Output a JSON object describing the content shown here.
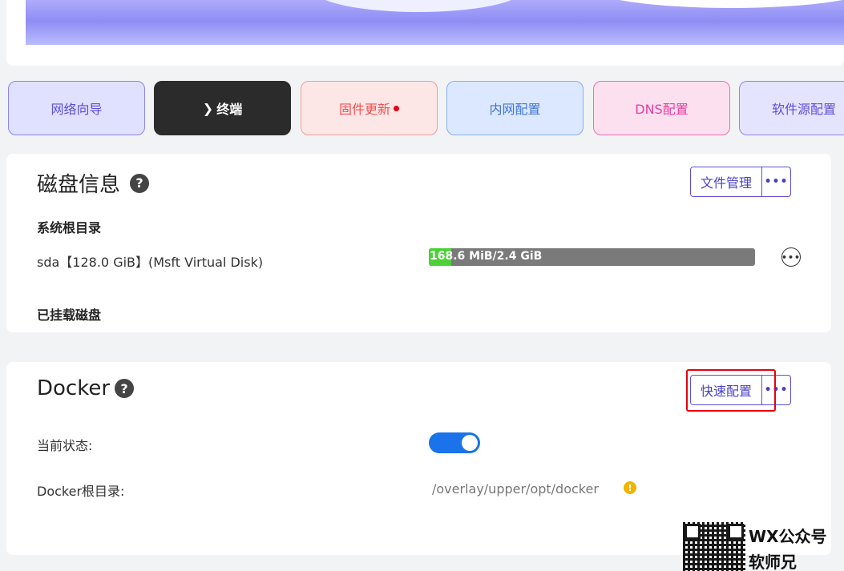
{
  "quick_buttons": {
    "network_wizard": "网络向导",
    "terminal": "终端",
    "firmware_update": "固件更新",
    "lan_config": "内网配置",
    "dns_config": "DNS配置",
    "software_source": "软件源配置"
  },
  "disk_card": {
    "title": "磁盘信息",
    "file_manage_label": "文件管理",
    "system_root_label": "系统根目录",
    "disk_name": "sda【128.0 GiB】(Msft Virtual Disk)",
    "usage_text": "168.6 MiB/2.4 GiB",
    "usage_fraction": 0.07,
    "mounted_label": "已挂载磁盘"
  },
  "docker_card": {
    "title": "Docker",
    "quick_config_label": "快速配置",
    "status_label": "当前状态:",
    "status_on": true,
    "root_dir_label": "Docker根目录:",
    "root_dir_value": "/overlay/upper/opt/docker"
  },
  "watermark": {
    "line1": "WX公众号",
    "line2": "软师兄"
  },
  "colors": {
    "accent": "#5b4fd6",
    "highlight": "#e60012",
    "toggle_on": "#1a73e8",
    "usage_fill": "#4cd137"
  }
}
